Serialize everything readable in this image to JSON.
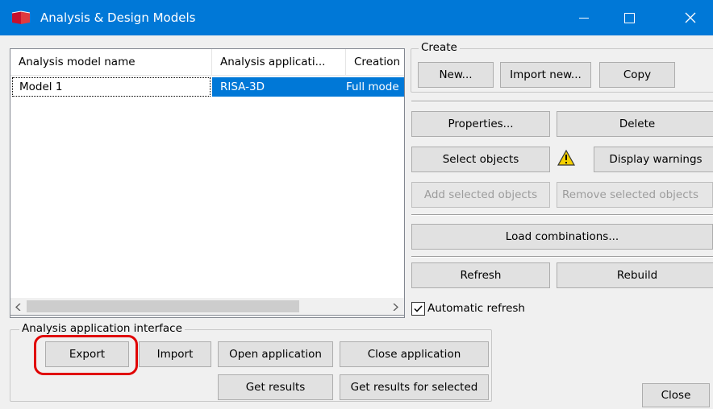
{
  "window": {
    "title": "Analysis & Design Models"
  },
  "colors": {
    "titlebar": "#0078d7",
    "selection": "#0078d7",
    "highlight_box": "#e00000",
    "warning": "#f5d000"
  },
  "list": {
    "columns": [
      "Analysis model name",
      "Analysis applicati...",
      "Creation r"
    ],
    "rows": [
      {
        "name": "Model 1",
        "application": "RISA-3D",
        "creation": "Full mode"
      }
    ]
  },
  "create": {
    "legend": "Create",
    "new_label": "New...",
    "import_new_label": "Import new...",
    "copy_label": "Copy"
  },
  "actions": {
    "properties_label": "Properties...",
    "delete_label": "Delete",
    "select_objects_label": "Select objects",
    "display_warnings_label": "Display warnings",
    "add_selected_label": "Add selected objects",
    "remove_selected_label": "Remove selected objects",
    "load_combinations_label": "Load combinations...",
    "refresh_label": "Refresh",
    "rebuild_label": "Rebuild",
    "auto_refresh_label": "Automatic refresh",
    "auto_refresh_checked": true
  },
  "interface": {
    "legend": "Analysis application interface",
    "export_label": "Export",
    "import_label": "Import",
    "open_app_label": "Open application",
    "close_app_label": "Close application",
    "get_results_label": "Get results",
    "get_results_selected_label": "Get results for selected"
  },
  "footer": {
    "close_label": "Close"
  }
}
